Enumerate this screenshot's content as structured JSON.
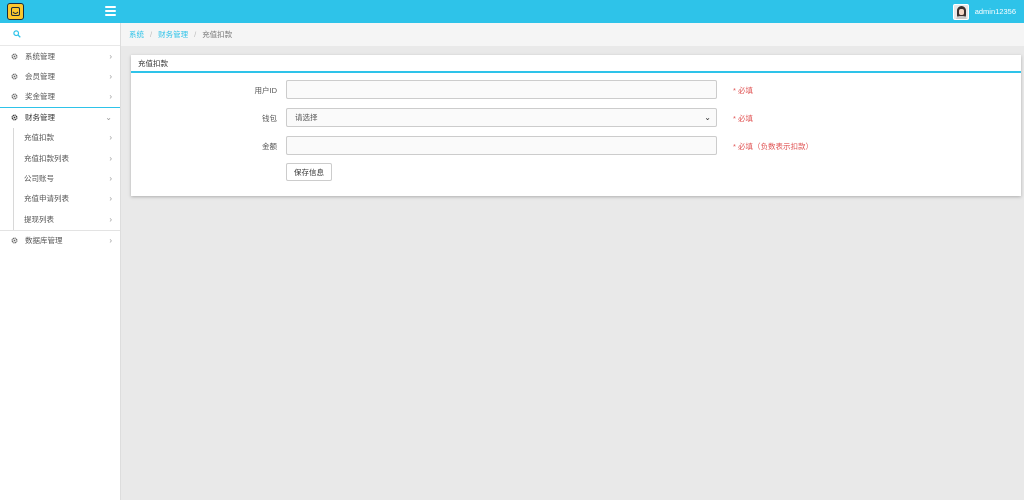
{
  "header": {
    "username": "admin12356",
    "brand_color": "#2ec3e9"
  },
  "sidebar": {
    "search_icon": "search-icon",
    "items": [
      {
        "label": "系统管理",
        "icon": "gear-icon"
      },
      {
        "label": "会员管理",
        "icon": "gear-icon"
      },
      {
        "label": "奖金管理",
        "icon": "gear-icon"
      },
      {
        "label": "财务管理",
        "icon": "gear-icon",
        "expanded": true
      },
      {
        "label": "数据库管理",
        "icon": "gear-icon"
      }
    ],
    "submenu": [
      {
        "label": "充值扣款"
      },
      {
        "label": "充值扣款列表"
      },
      {
        "label": "公司账号"
      },
      {
        "label": "充值申请列表"
      },
      {
        "label": "提现列表"
      }
    ]
  },
  "breadcrumb": {
    "root": "系统",
    "parent": "财务管理",
    "current": "充值扣款"
  },
  "panel": {
    "title": "充值扣款",
    "fields": {
      "user_id_label": "用户ID",
      "user_id_value": "",
      "user_id_hint": "* 必填",
      "wallet_label": "钱包",
      "wallet_selected": "请选择",
      "wallet_hint": "* 必填",
      "amount_label": "金额",
      "amount_value": "",
      "amount_hint": "* 必填（负数表示扣款）"
    },
    "save_label": "保存信息"
  }
}
